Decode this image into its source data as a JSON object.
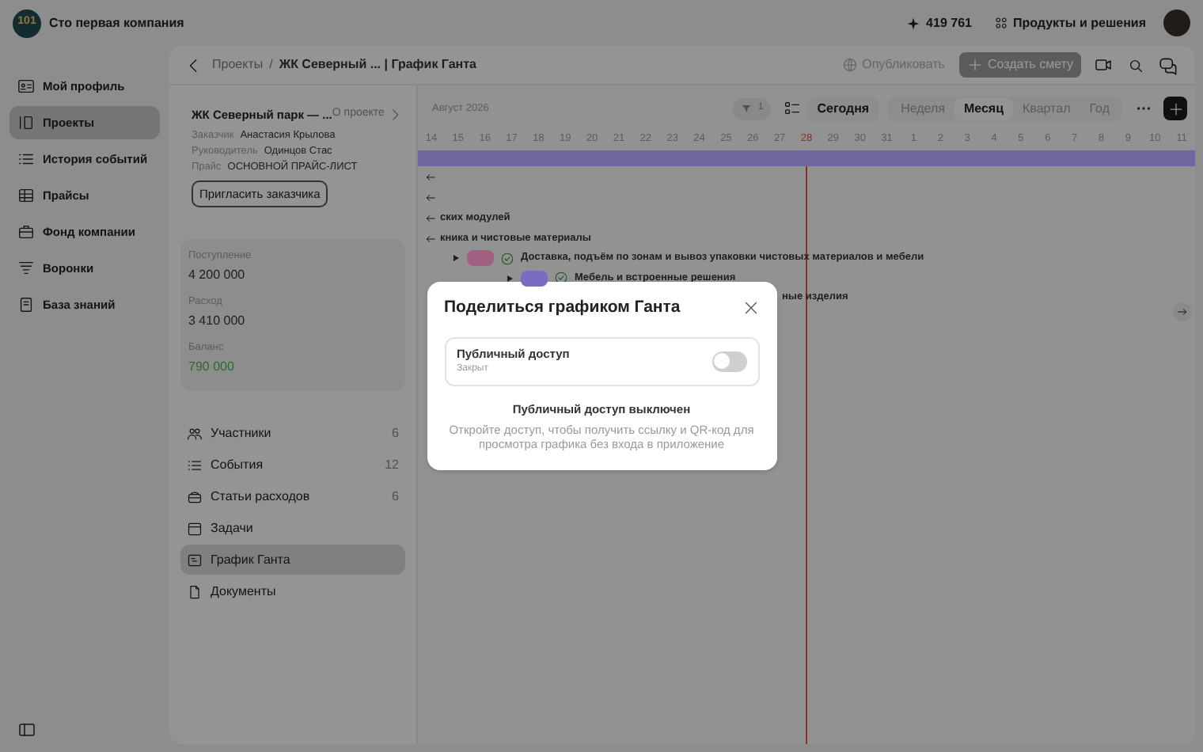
{
  "header": {
    "logo": "101",
    "company": "Сто первая компания",
    "balance": "419 761",
    "products": "Продукты и решения"
  },
  "sidebar": {
    "items": [
      {
        "label": "Мой профиль",
        "selected": false
      },
      {
        "label": "Проекты",
        "selected": true
      },
      {
        "label": "История событий",
        "selected": false
      },
      {
        "label": "Прайсы",
        "selected": false
      },
      {
        "label": "Фонд компании",
        "selected": false
      },
      {
        "label": "Воронки",
        "selected": false
      },
      {
        "label": "База знаний",
        "selected": false
      }
    ]
  },
  "breadcrumb": {
    "parent": "Проекты",
    "separator": "/",
    "current": "ЖК Северный ... | График Ганта"
  },
  "toolbar": {
    "publish": "Опубликовать",
    "create_estimate": "Создать смету"
  },
  "project": {
    "title": "ЖК Северный парк — ...",
    "about": "О проекте",
    "fields": [
      {
        "label": "Заказчик",
        "value": "Анастасия Крылова"
      },
      {
        "label": "Руководитель",
        "value": "Одинцов Стас"
      },
      {
        "label": "Прайс",
        "value": "ОСНОВНОЙ ПРАЙС-ЛИСТ"
      }
    ],
    "invite": "Пригласить заказчика",
    "stats": [
      {
        "label": "Поступление",
        "value": "4 200 000",
        "positive": false
      },
      {
        "label": "Расход",
        "value": "3 410 000",
        "positive": false
      },
      {
        "label": "Баланс",
        "value": "790 000",
        "positive": true
      }
    ],
    "menu": [
      {
        "label": "Участники",
        "count": "6",
        "selected": false
      },
      {
        "label": "События",
        "count": "12",
        "selected": false
      },
      {
        "label": "Статьи расходов",
        "count": "6",
        "selected": false
      },
      {
        "label": "Задачи",
        "selected": false
      },
      {
        "label": "График Ганта",
        "selected": true
      },
      {
        "label": "Документы",
        "selected": false
      }
    ]
  },
  "gantt": {
    "month": "Август 2026",
    "filter_count": "1",
    "today": "Сегодня",
    "scales": [
      {
        "label": "Неделя",
        "selected": false
      },
      {
        "label": "Месяц",
        "selected": true
      },
      {
        "label": "Квартал",
        "selected": false
      },
      {
        "label": "Год",
        "selected": false
      }
    ],
    "days": [
      {
        "label": "14",
        "today": false
      },
      {
        "label": "15",
        "today": false
      },
      {
        "label": "16",
        "today": false
      },
      {
        "label": "17",
        "today": false
      },
      {
        "label": "18",
        "today": false
      },
      {
        "label": "19",
        "today": false
      },
      {
        "label": "20",
        "today": false
      },
      {
        "label": "21",
        "today": false
      },
      {
        "label": "22",
        "today": false
      },
      {
        "label": "23",
        "today": false
      },
      {
        "label": "24",
        "today": false
      },
      {
        "label": "25",
        "today": false
      },
      {
        "label": "26",
        "today": false
      },
      {
        "label": "27",
        "today": false
      },
      {
        "label": "28",
        "today": true
      },
      {
        "label": "29",
        "today": false
      },
      {
        "label": "30",
        "today": false
      },
      {
        "label": "31",
        "today": false
      },
      {
        "label": "1",
        "today": false
      },
      {
        "label": "2",
        "today": false
      },
      {
        "label": "3",
        "today": false
      },
      {
        "label": "4",
        "today": false
      },
      {
        "label": "5",
        "today": false
      },
      {
        "label": "6",
        "today": false
      },
      {
        "label": "7",
        "today": false
      },
      {
        "label": "8",
        "today": false
      },
      {
        "label": "9",
        "today": false
      },
      {
        "label": "10",
        "today": false
      },
      {
        "label": "11",
        "today": false
      }
    ],
    "rows": [
      {
        "kind": "summary",
        "color": "#6e67a0"
      },
      {
        "kind": "arrow"
      },
      {
        "kind": "arrow"
      },
      {
        "kind": "label",
        "text": "ских модулей"
      },
      {
        "kind": "label",
        "text": "кника и чистовые материалы"
      },
      {
        "kind": "task",
        "text": "Доставка, подъём по зонам и вывоз упаковки чистовых материалов и мебели",
        "color": "#a06082",
        "done": true,
        "children": [
          {
            "kind": "task",
            "text": "Мебель и встроенные решения",
            "color": "#7a6cc0",
            "done": true
          },
          {
            "kind": "fragment",
            "text": "ные изделия"
          }
        ]
      }
    ]
  },
  "dialog": {
    "title": "Поделиться графиком Ганта",
    "option": {
      "label": "Публичный доступ",
      "status": "Закрыт",
      "on": false
    },
    "notice": "Публичный доступ выключен",
    "description": "Откройте доступ, чтобы получить ссылку и QR-код для просмотра графика без входа в приложение"
  }
}
